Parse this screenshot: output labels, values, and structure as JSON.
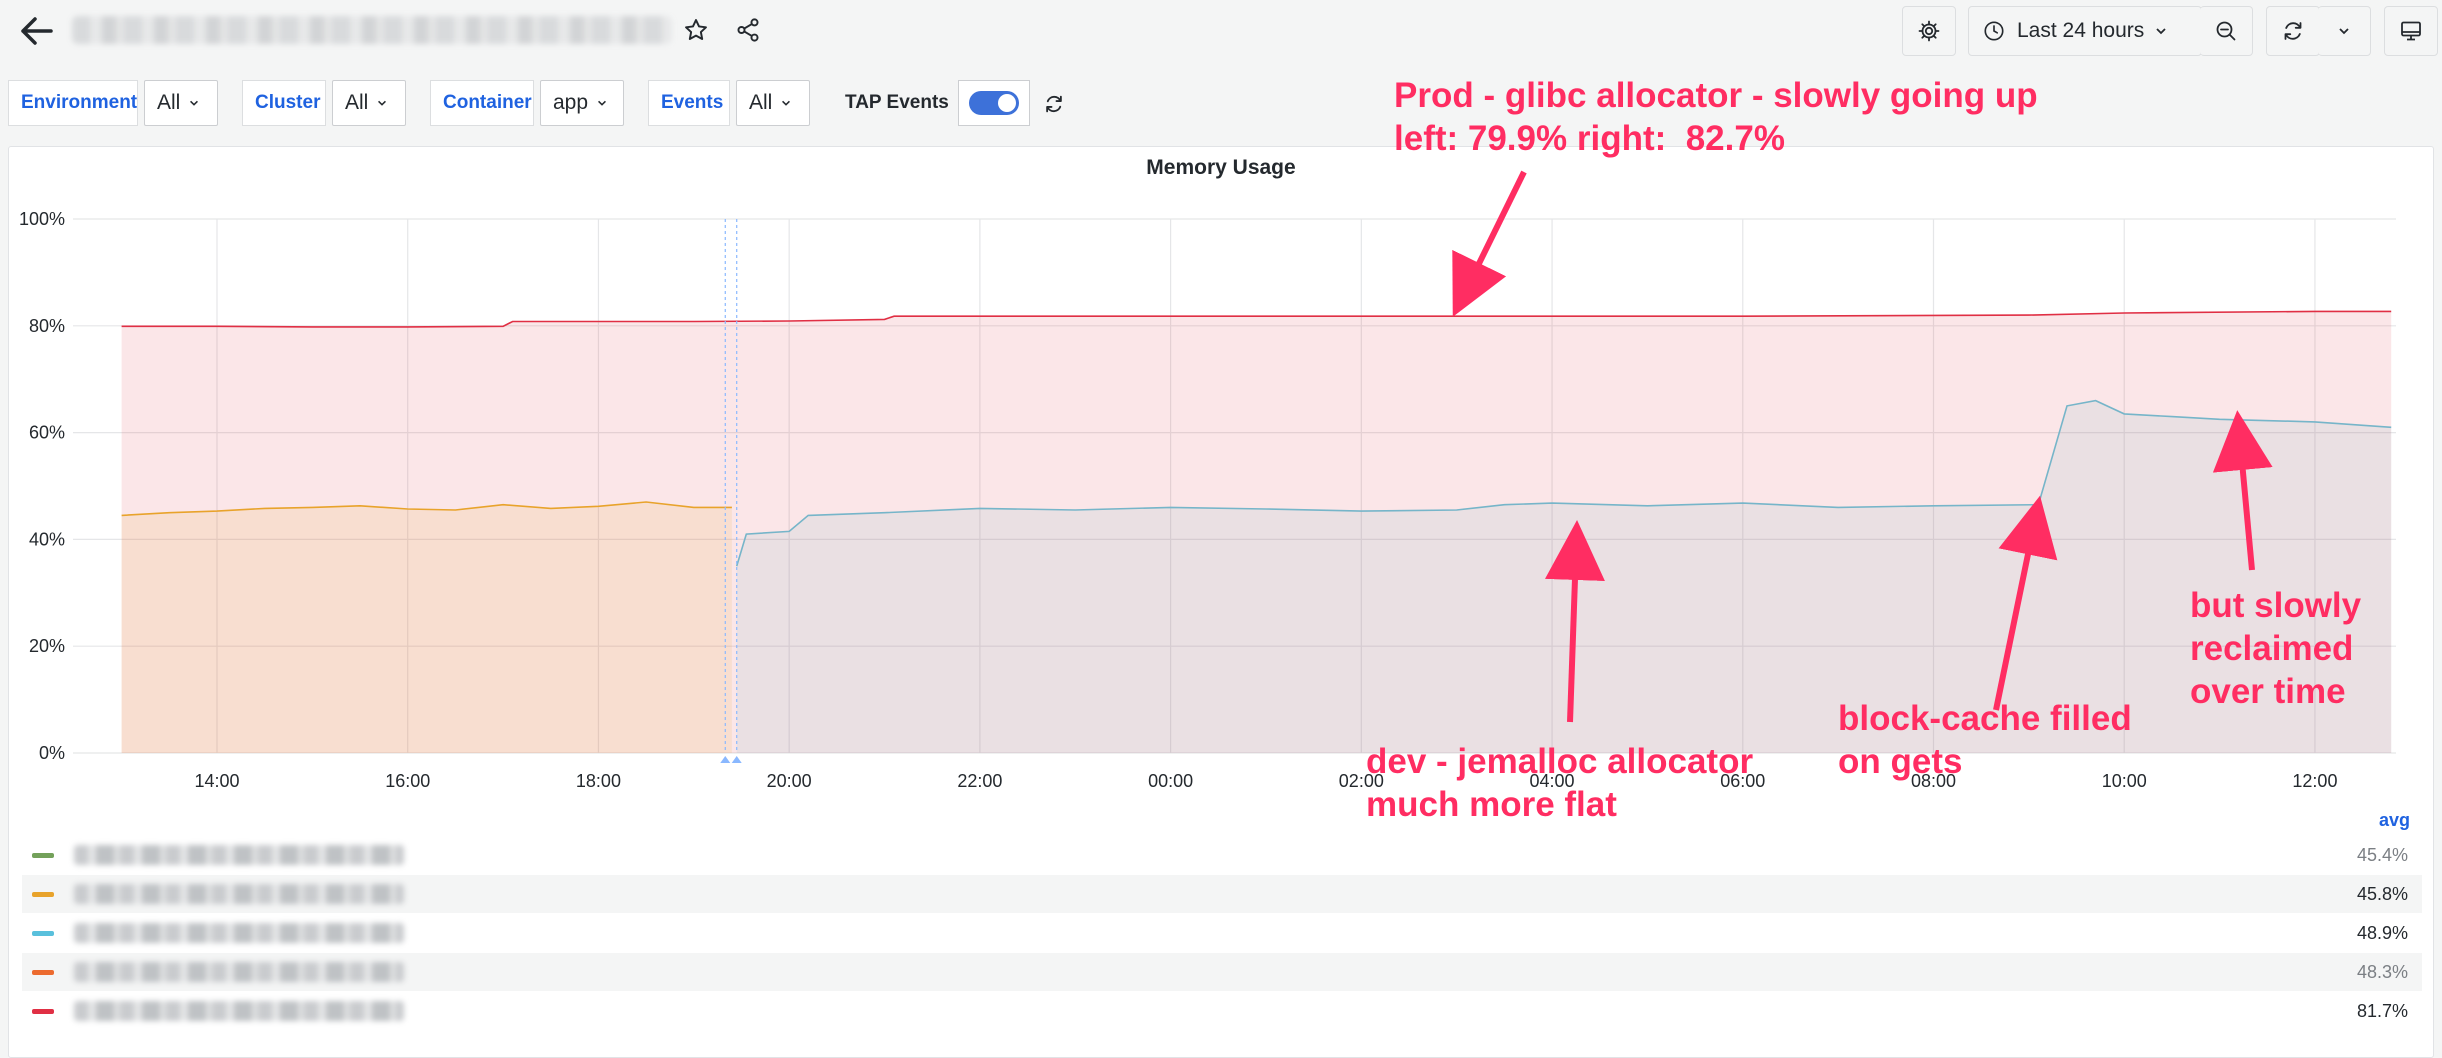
{
  "toolbar": {
    "time_range": "Last 24 hours"
  },
  "variables": [
    {
      "label": "Environment",
      "value": "All"
    },
    {
      "label": "Cluster",
      "value": "All"
    },
    {
      "label": "Container",
      "value": "app"
    },
    {
      "label": "Events",
      "value": "All"
    }
  ],
  "tap_events": {
    "label": "TAP Events",
    "enabled": true
  },
  "panel": {
    "title": "Memory Usage"
  },
  "chart_data": {
    "type": "area",
    "title": "Memory Usage",
    "ylim": [
      0,
      100
    ],
    "y_ticks": [
      "100%",
      "80%",
      "60%",
      "40%",
      "20%",
      "0%"
    ],
    "x_ticks": [
      "14:00",
      "16:00",
      "18:00",
      "20:00",
      "22:00",
      "00:00",
      "02:00",
      "04:00",
      "06:00",
      "08:00",
      "10:00",
      "12:00"
    ],
    "grid": true,
    "series": [
      {
        "color": "#e02f44",
        "x": [
          13.0,
          14.0,
          15.0,
          16.0,
          17.0,
          17.1,
          19.0,
          20.0,
          21.0,
          21.1,
          24.0,
          27.0,
          30.0,
          33.0,
          34.0,
          36.0,
          36.8
        ],
        "values": [
          79.9,
          79.9,
          79.8,
          79.8,
          79.9,
          80.8,
          80.8,
          80.9,
          81.2,
          81.8,
          81.8,
          81.8,
          81.8,
          82.0,
          82.4,
          82.7,
          82.7
        ]
      },
      {
        "color": "#e8a32b",
        "x": [
          13.0,
          13.5,
          14.0,
          14.5,
          15.0,
          15.5,
          16.0,
          16.5,
          17.0,
          17.5,
          18.0,
          18.5,
          19.0,
          19.4
        ],
        "values": [
          44.5,
          45.0,
          45.3,
          45.8,
          46.0,
          46.3,
          45.7,
          45.5,
          46.5,
          45.8,
          46.2,
          47.0,
          46.0,
          46.0
        ]
      },
      {
        "color": "#76b5c9",
        "x": [
          19.45,
          19.55,
          20.0,
          20.2,
          21.0,
          22.0,
          23.0,
          24.0,
          25.0,
          26.0,
          27.0,
          27.5,
          28.0,
          29.0,
          30.0,
          31.0,
          32.0,
          33.1,
          33.4,
          33.7,
          34.0,
          34.5,
          35.0,
          36.0,
          36.8
        ],
        "values": [
          35.0,
          41.0,
          41.5,
          44.5,
          45.0,
          45.8,
          45.5,
          46.0,
          45.7,
          45.3,
          45.5,
          46.5,
          46.8,
          46.3,
          46.8,
          46.0,
          46.3,
          46.5,
          65.0,
          66.0,
          63.5,
          63.0,
          62.5,
          62.0,
          61.0
        ]
      }
    ]
  },
  "legend": {
    "header": "avg",
    "rows": [
      {
        "color": "#73a15a",
        "value": "45.4%",
        "dim": true
      },
      {
        "color": "#e8a32b",
        "value": "45.8%",
        "dim": false
      },
      {
        "color": "#59c0dc",
        "value": "48.9%",
        "dim": false
      },
      {
        "color": "#ec6b2f",
        "value": "48.3%",
        "dim": true
      },
      {
        "color": "#e02f44",
        "value": "81.7%",
        "dim": false
      }
    ]
  },
  "annotations": {
    "prod": "Prod - glibc allocator - slowly going up\nleft: 79.9% right:  82.7%",
    "dev": "dev - jemalloc allocator\nmuch more flat",
    "block": "block-cache filled\non gets",
    "reclaim": "but slowly\nreclaimed\nover time"
  },
  "colors": {
    "accent": "#1f62e0",
    "annotation": "#ff2d62"
  }
}
